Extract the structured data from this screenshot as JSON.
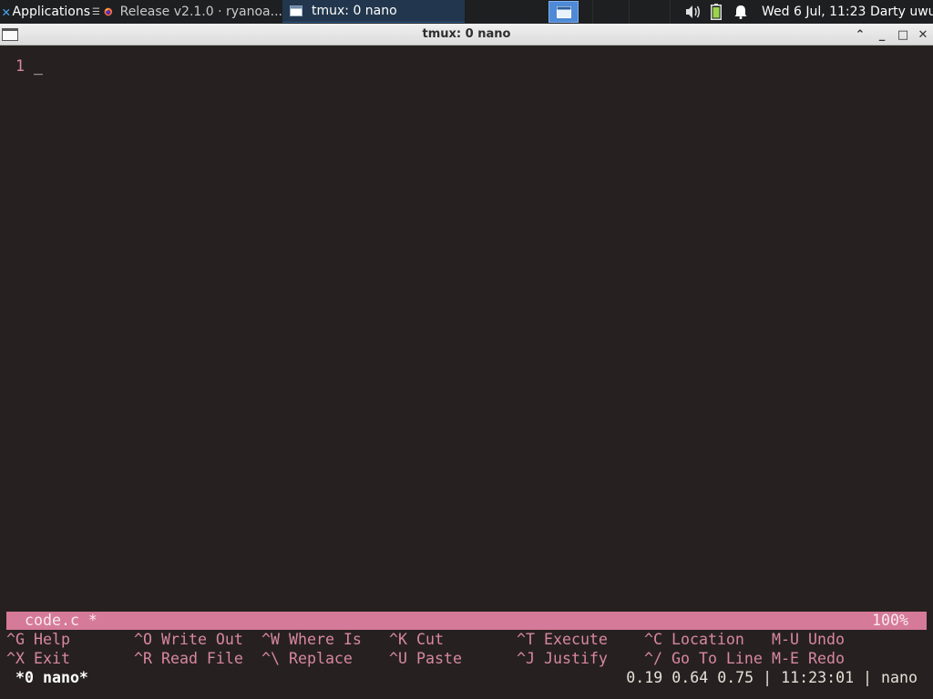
{
  "panel": {
    "applications_label": "Applications",
    "applications_glyph": "☰",
    "tasks": [
      {
        "label": "Release v2.1.0 · ryanoa..."
      },
      {
        "label": "tmux: 0 nano"
      }
    ],
    "clock": "Wed  6 Jul, 11:23",
    "user": "Darty uwu",
    "icons": [
      "xfce-icon",
      "firefox-icon",
      "window-icon",
      "show-desktop-icon",
      "volume-icon",
      "battery-icon",
      "notification-bell-icon"
    ],
    "colors": {
      "panel_bg": "#1d1f21",
      "active_task_bg": "#22374d",
      "show_desktop_bg": "#4e8ad6",
      "battery": "#9bd64a"
    }
  },
  "window": {
    "title": "tmux: 0 nano",
    "controls": {
      "shade": "⌃",
      "minimize": "_",
      "maximize": "□",
      "close": "✕"
    }
  },
  "editor": {
    "line_number": "1",
    "cursor": "_",
    "status": {
      "filename": "code.c *",
      "percent": "100%"
    },
    "shortcuts_row1": [
      {
        "key": "^G",
        "desc": "Help"
      },
      {
        "key": "^O",
        "desc": "Write Out"
      },
      {
        "key": "^W",
        "desc": "Where Is"
      },
      {
        "key": "^K",
        "desc": "Cut"
      },
      {
        "key": "^T",
        "desc": "Execute"
      },
      {
        "key": "^C",
        "desc": "Location"
      },
      {
        "key": "M-U",
        "desc": "Undo"
      }
    ],
    "shortcuts_row2": [
      {
        "key": "^X",
        "desc": "Exit"
      },
      {
        "key": "^R",
        "desc": "Read File"
      },
      {
        "key": "^\\",
        "desc": "Replace"
      },
      {
        "key": "^U",
        "desc": "Paste"
      },
      {
        "key": "^J",
        "desc": "Justify"
      },
      {
        "key": "^/",
        "desc": "Go To Line"
      },
      {
        "key": "M-E",
        "desc": "Redo"
      }
    ],
    "colors": {
      "background": "#262120",
      "accent": "#d886a4",
      "status_bg": "#d57a99",
      "text": "#e6dfd9"
    }
  },
  "tmux": {
    "window": "*0 nano*",
    "right": "0.19 0.64 0.75 | 11:23:01 | nano"
  }
}
